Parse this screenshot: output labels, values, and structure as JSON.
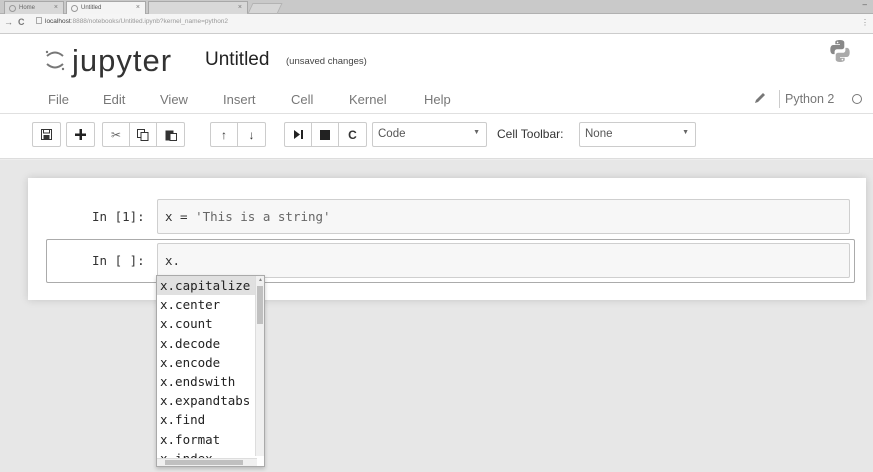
{
  "browser": {
    "tabs": [
      {
        "label": "Home"
      },
      {
        "label": "Untitled"
      }
    ],
    "url_host": "localhost",
    "url_path": ":8888/notebooks/Untitled.ipynb?kernel_name=python2"
  },
  "header": {
    "logo_text": "jupyter",
    "notebook_title": "Untitled",
    "save_status": "(unsaved changes)"
  },
  "menubar": {
    "items": [
      "File",
      "Edit",
      "View",
      "Insert",
      "Cell",
      "Kernel",
      "Help"
    ],
    "kernel_name": "Python 2"
  },
  "toolbar": {
    "cell_type": "Code",
    "cell_toolbar_label": "Cell Toolbar:",
    "cell_toolbar_value": "None"
  },
  "cells": [
    {
      "prompt": "In [1]:",
      "code_prefix": "x = ",
      "code_string": "'This is a string'"
    },
    {
      "prompt": "In [ ]:",
      "code": "x."
    }
  ],
  "completer": {
    "items": [
      "x.capitalize",
      "x.center",
      "x.count",
      "x.decode",
      "x.encode",
      "x.endswith",
      "x.expandtabs",
      "x.find",
      "x.format",
      "x.index"
    ],
    "selected_index": 0
  }
}
